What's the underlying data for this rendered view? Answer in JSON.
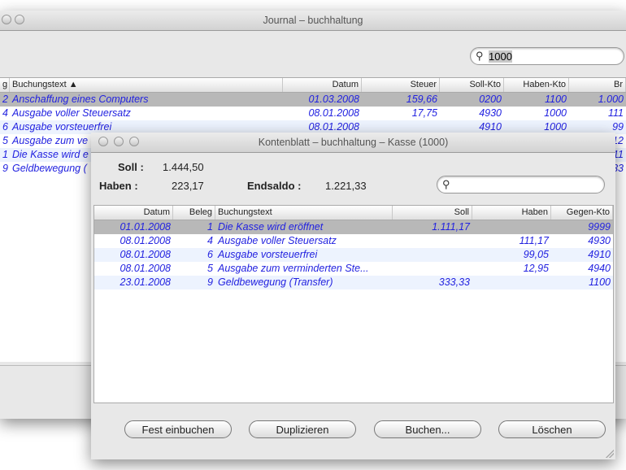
{
  "journal": {
    "title": "Journal – buchhaltung",
    "search_value": "1000",
    "columns": [
      "g",
      "Buchungstext ▲",
      "Datum",
      "Steuer",
      "Soll-Kto",
      "Haben-Kto",
      "Br"
    ],
    "rows": [
      [
        "2",
        "Anschaffung eines Computers",
        "01.03.2008",
        "159,66",
        "0200",
        "1100",
        "1.000"
      ],
      [
        "4",
        "Ausgabe voller Steuersatz",
        "08.01.2008",
        "17,75",
        "4930",
        "1000",
        "111"
      ],
      [
        "6",
        "Ausgabe vorsteuerfrei",
        "08.01.2008",
        "",
        "4910",
        "1000",
        "99"
      ],
      [
        "5",
        "Ausgabe zum ve",
        "",
        "",
        "",
        "",
        "12"
      ],
      [
        "1",
        "Die Kasse wird e",
        "",
        "",
        "",
        "",
        "11"
      ],
      [
        "9",
        "Geldbewegung (",
        "",
        "",
        "",
        "",
        "33"
      ]
    ]
  },
  "konto": {
    "title": "Kontenblatt – buchhaltung – Kasse (1000)",
    "soll_label": "Soll :",
    "soll_value": "1.444,50",
    "haben_label": "Haben :",
    "haben_value": "223,17",
    "endsaldo_label": "Endsaldo :",
    "endsaldo_value": "1.221,33",
    "search_value": "",
    "columns": [
      "Datum",
      "Beleg",
      "Buchungstext",
      "Soll",
      "Haben",
      "Gegen-Kto"
    ],
    "rows": [
      [
        "01.01.2008",
        "1",
        "Die Kasse wird eröffnet",
        "1.111,17",
        "",
        "9999"
      ],
      [
        "08.01.2008",
        "4",
        "Ausgabe voller Steuersatz",
        "",
        "111,17",
        "4930"
      ],
      [
        "08.01.2008",
        "6",
        "Ausgabe vorsteuerfrei",
        "",
        "99,05",
        "4910"
      ],
      [
        "08.01.2008",
        "5",
        "Ausgabe zum verminderten Ste...",
        "",
        "12,95",
        "4940"
      ],
      [
        "23.01.2008",
        "9",
        "Geldbewegung (Transfer)",
        "333,33",
        "",
        "1100"
      ]
    ],
    "buttons": [
      "Fest einbuchen",
      "Duplizieren",
      "Buchen...",
      "Löschen"
    ]
  },
  "icons": {
    "search": "🔍"
  }
}
